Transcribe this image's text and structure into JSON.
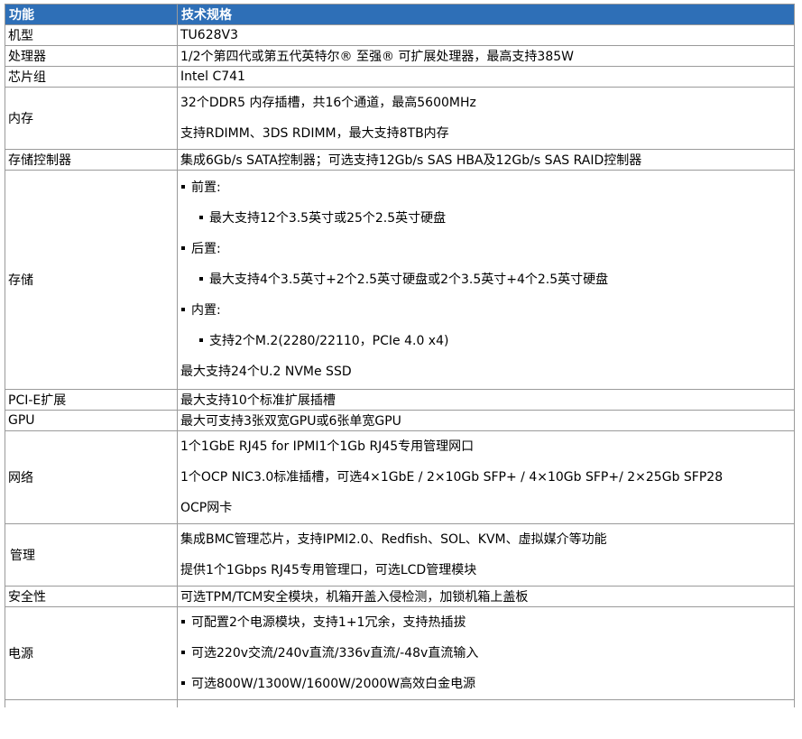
{
  "header": {
    "col1": "功能",
    "col2": "技术规格"
  },
  "rows": {
    "model": {
      "label": "机型",
      "value": "TU628V3"
    },
    "cpu": {
      "label": "处理器",
      "value": "1/2个第四代或第五代英特尔® 至强® 可扩展处理器，最高支持385W"
    },
    "chipset": {
      "label": "芯片组",
      "value": "Intel C741"
    },
    "memory": {
      "label": "内存",
      "lines": [
        "32个DDR5 内存插槽，共16个通道，最高5600MHz",
        "支持RDIMM、3DS RDIMM，最大支持8TB内存"
      ]
    },
    "storage_ctrl": {
      "label": "存储控制器",
      "value": "集成6Gb/s SATA控制器；可选支持12Gb/s SAS HBA及12Gb/s SAS RAID控制器"
    },
    "storage": {
      "label": "存储",
      "front_title": "前置:",
      "front_item": "最大支持12个3.5英寸或25个2.5英寸硬盘",
      "rear_title": "后置:",
      "rear_item": "最大支持4个3.5英寸+2个2.5英寸硬盘或2个3.5英寸+4个2.5英寸硬盘",
      "internal_title": "内置:",
      "internal_item": "支持2个M.2(2280/22110，PCIe 4.0 x4)",
      "nvme": "最大支持24个U.2 NVMe SSD"
    },
    "pcie": {
      "label": "PCI-E扩展",
      "value": "最大支持10个标准扩展插槽"
    },
    "gpu": {
      "label": "GPU",
      "value": "最大可支持3张双宽GPU或6张单宽GPU"
    },
    "network": {
      "label": "网络",
      "lines": [
        "1个1GbE RJ45 for IPMI1个1Gb RJ45专用管理网口",
        "1个OCP NIC3.0标准插槽，可选4×1GbE / 2×10Gb SFP+ / 4×10Gb SFP+/ 2×25Gb SFP28",
        "OCP网卡"
      ]
    },
    "management": {
      "label": "管理",
      "lines": [
        "集成BMC管理芯片，支持IPMI2.0、Redfish、SOL、KVM、虚拟媒介等功能",
        "提供1个1Gbps RJ45专用管理口，可选LCD管理模块"
      ]
    },
    "security": {
      "label": "安全性",
      "value": "可选TPM/TCM安全模块，机箱开盖入侵检测，加锁机箱上盖板"
    },
    "power": {
      "label": "电源",
      "lines": [
        "可配置2个电源模块，支持1+1冗余，支持热插拔",
        "可选220v交流/240v直流/336v直流/-48v直流输入",
        "可选800W/1300W/1600W/2000W高效白金电源"
      ]
    }
  }
}
